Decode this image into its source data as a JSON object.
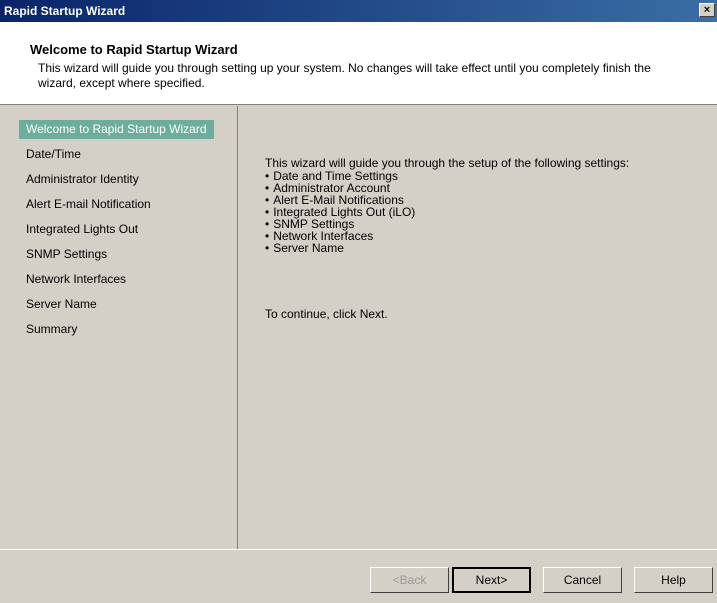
{
  "window": {
    "title": "Rapid Startup Wizard",
    "close_label": "×"
  },
  "header": {
    "title": "Welcome to Rapid Startup Wizard",
    "description": "This wizard will guide you through setting up your system.  No changes will take effect until you completely finish the wizard, except where specified."
  },
  "sidebar": {
    "active_index": 0,
    "items": [
      {
        "label": "Welcome to Rapid Startup Wizard"
      },
      {
        "label": "Date/Time"
      },
      {
        "label": "Administrator Identity"
      },
      {
        "label": "Alert E-mail Notification"
      },
      {
        "label": "Integrated Lights Out"
      },
      {
        "label": "SNMP Settings"
      },
      {
        "label": "Network Interfaces"
      },
      {
        "label": "Server Name"
      },
      {
        "label": "Summary"
      }
    ]
  },
  "content": {
    "intro": "This wizard will guide you through the setup of the following settings:",
    "bullets": [
      "Date and Time Settings",
      "Administrator Account",
      "Alert E-Mail Notifications",
      "Integrated Lights Out (iLO)",
      "SNMP Settings",
      "Network Interfaces",
      "Server Name"
    ],
    "continue_text": "To continue, click Next."
  },
  "footer": {
    "back_label": "<Back",
    "next_label": "Next>",
    "cancel_label": "Cancel",
    "help_label": "Help"
  },
  "colors": {
    "titlebar_start": "#0a246a",
    "titlebar_end": "#3a6ea5",
    "active_item": "#6cae9b",
    "dialog_bg": "#d4d0c8"
  }
}
